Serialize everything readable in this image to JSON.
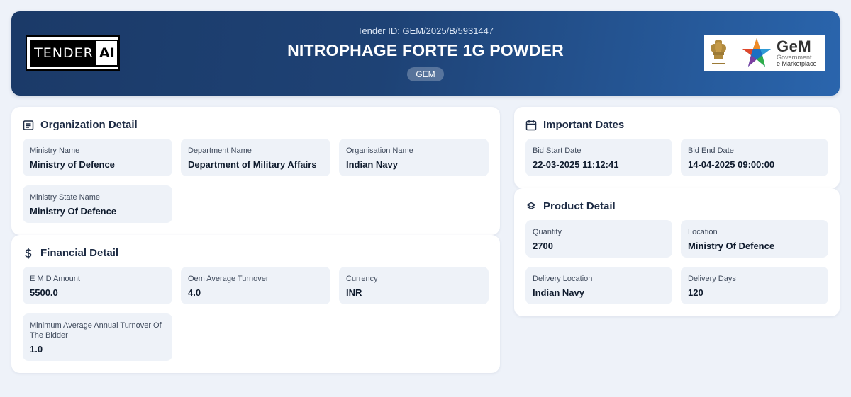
{
  "header": {
    "logo_word": "TENDER",
    "logo_ai": "AI",
    "tender_id": "Tender ID: GEM/2025/B/5931447",
    "title": "NITROPHAGE FORTE 1G POWDER",
    "badge": "GEM",
    "gem_logo": {
      "big": "GeM",
      "line1": "Government",
      "line2": "e Marketplace"
    }
  },
  "organization": {
    "title": "Organization Detail",
    "icon": "list-icon",
    "fields": [
      {
        "label": "Ministry Name",
        "value": "Ministry of Defence"
      },
      {
        "label": "Department Name",
        "value": "Department of Military Affairs"
      },
      {
        "label": "Organisation Name",
        "value": "Indian Navy"
      },
      {
        "label": "Ministry State Name",
        "value": "Ministry Of Defence"
      }
    ]
  },
  "financial": {
    "title": "Financial Detail",
    "icon": "dollar-icon",
    "fields": [
      {
        "label": "E M D Amount",
        "value": "5500.0"
      },
      {
        "label": "Oem Average Turnover",
        "value": "4.0"
      },
      {
        "label": "Currency",
        "value": "INR"
      },
      {
        "label": "Minimum Average Annual Turnover Of The Bidder",
        "value": "1.0"
      }
    ]
  },
  "dates": {
    "title": "Important Dates",
    "icon": "calendar-icon",
    "fields": [
      {
        "label": "Bid Start Date",
        "value": "22-03-2025 11:12:41"
      },
      {
        "label": "Bid End Date",
        "value": "14-04-2025 09:00:00"
      }
    ]
  },
  "product": {
    "title": "Product Detail",
    "icon": "layers-icon",
    "fields": [
      {
        "label": "Quantity",
        "value": "2700"
      },
      {
        "label": "Location",
        "value": "Ministry Of Defence"
      },
      {
        "label": "Delivery Location",
        "value": "Indian Navy"
      },
      {
        "label": "Delivery Days",
        "value": "120"
      }
    ]
  },
  "colors": {
    "header_start": "#1b3a68",
    "header_end": "#2a65ad",
    "page_bg": "#eef2f9",
    "field_bg": "#eef2f8"
  }
}
